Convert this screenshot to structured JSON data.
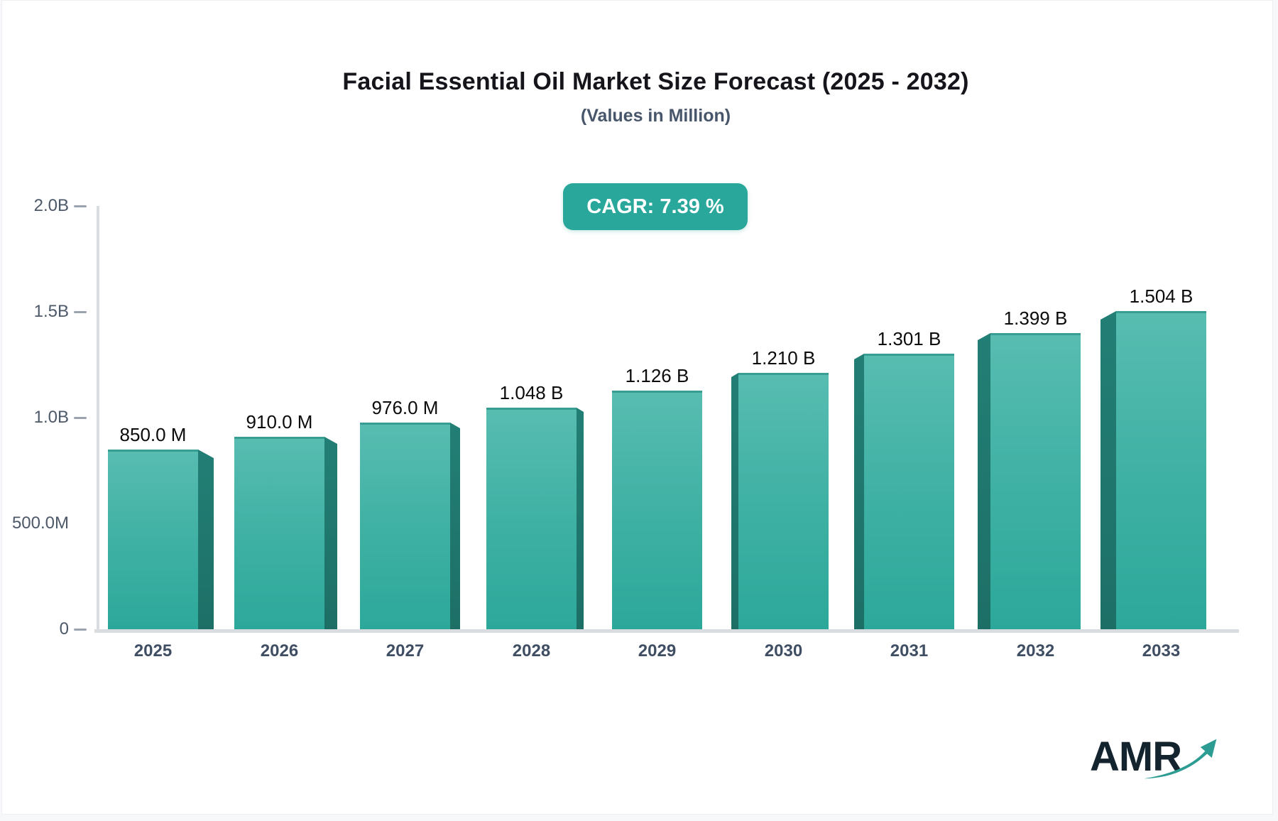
{
  "header": {
    "title": "Facial Essential Oil Market Size Forecast (2025 - 2032)",
    "subtitle": "(Values in Million)",
    "cagr_label": "CAGR: 7.39 %"
  },
  "chart_data": {
    "type": "bar",
    "title": "Facial Essential Oil Market Size Forecast (2025 - 2032)",
    "subtitle": "(Values in Million)",
    "cagr_percent": 7.39,
    "categories": [
      "2025",
      "2026",
      "2027",
      "2028",
      "2029",
      "2030",
      "2031",
      "2032",
      "2033"
    ],
    "values_millions": [
      850,
      910,
      976,
      1048,
      1126,
      1210,
      1301,
      1399,
      1504
    ],
    "value_labels": [
      "850.0 M",
      "910.0 M",
      "976.0 M",
      "1.048 B",
      "1.126 B",
      "1.210 B",
      "1.301 B",
      "1.399 B",
      "1.504 B"
    ],
    "ylim_millions": [
      0,
      2000
    ],
    "y_axis_ticks": [
      {
        "label": "2.0B",
        "value_millions": 2000,
        "has_dash": true
      },
      {
        "label": "1.5B",
        "value_millions": 1500,
        "has_dash": true
      },
      {
        "label": "1.0B",
        "value_millions": 1000,
        "has_dash": true
      },
      {
        "label": "500.0M",
        "value_millions": 500,
        "has_dash": false
      },
      {
        "label": "0",
        "value_millions": 0,
        "has_dash": true
      }
    ],
    "grid": "off",
    "legend": "none",
    "colors": {
      "bar_face_top": "#58bcb1",
      "bar_face_bottom": "#2ca89a",
      "bar_side": "#20786e",
      "bar_top_edge": "#389e93",
      "badge_background": "#2aa79b",
      "axis_line": "#d9dce1",
      "tick_dash": "#9aa3ae"
    }
  },
  "logo": {
    "text": "AMR"
  }
}
